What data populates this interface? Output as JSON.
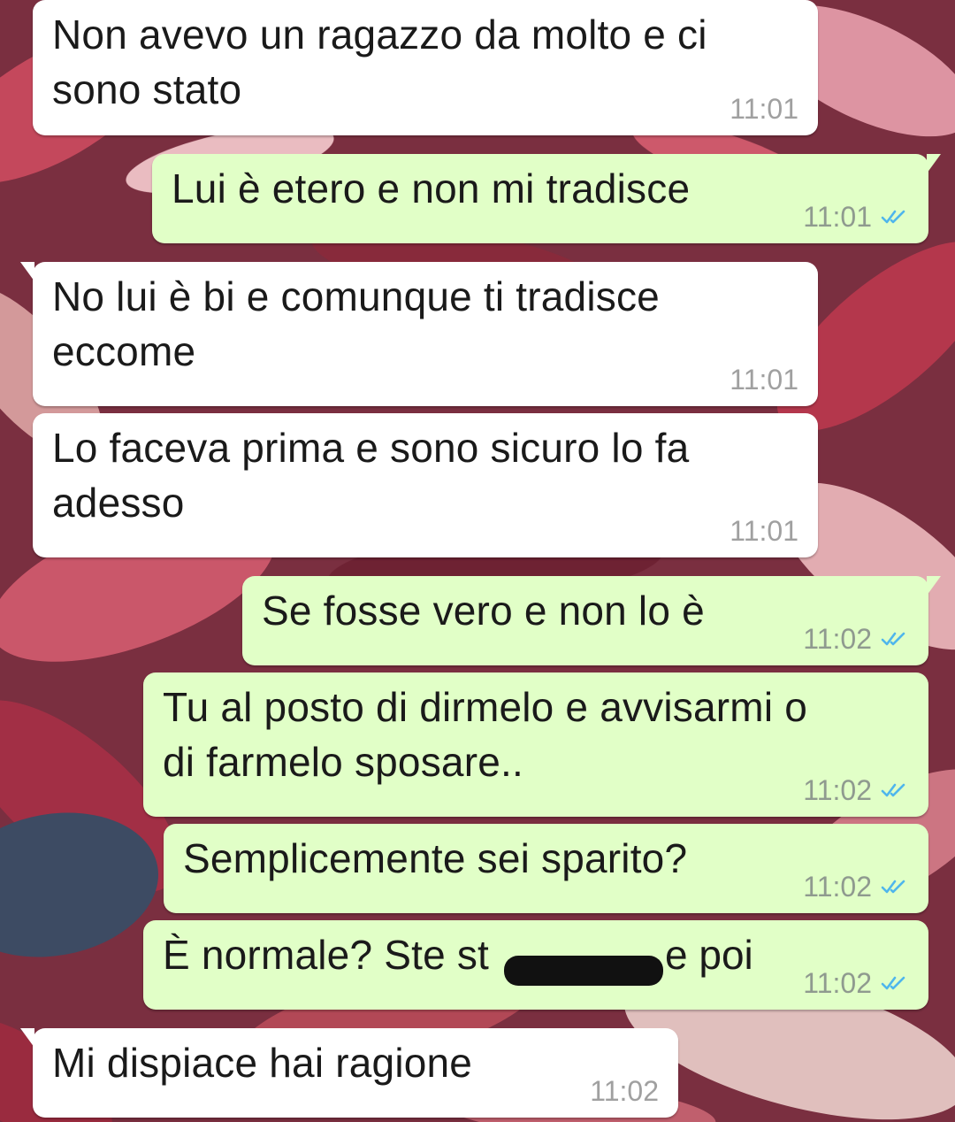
{
  "colors": {
    "incoming_bubble": "#ffffff",
    "outgoing_bubble": "#e1ffc7",
    "read_ticks": "#4fb6ec",
    "timestamp": "#9aa39a"
  },
  "messages": [
    {
      "direction": "in",
      "text": "Non avevo un ragazzo da molto e ci\nsono stato",
      "time": "11:01"
    },
    {
      "direction": "out",
      "text": "Lui è etero e non mi tradisce",
      "time": "11:01",
      "status": "read-double-check-icon"
    },
    {
      "direction": "in",
      "text": "No lui è bi e comunque ti tradisce\neccome",
      "time": "11:01"
    },
    {
      "direction": "in",
      "text": "Lo faceva prima e sono sicuro lo fa\nadesso",
      "time": "11:01"
    },
    {
      "direction": "out",
      "text": "Se fosse vero e non lo è",
      "time": "11:02",
      "status": "read-double-check-icon"
    },
    {
      "direction": "out",
      "text": "Tu al posto di dirmelo e avvisarmi o\ndi farmelo sposare..",
      "time": "11:02",
      "status": "read-double-check-icon"
    },
    {
      "direction": "out",
      "text": "Semplicemente sei sparito?",
      "time": "11:02",
      "status": "read-double-check-icon"
    },
    {
      "direction": "out",
      "text": "È normale? Ste st",
      "text_after": "e poi",
      "time": "11:02",
      "status": "read-double-check-icon"
    },
    {
      "direction": "in",
      "text": "Mi dispiace hai ragione",
      "time": "11:02"
    }
  ]
}
